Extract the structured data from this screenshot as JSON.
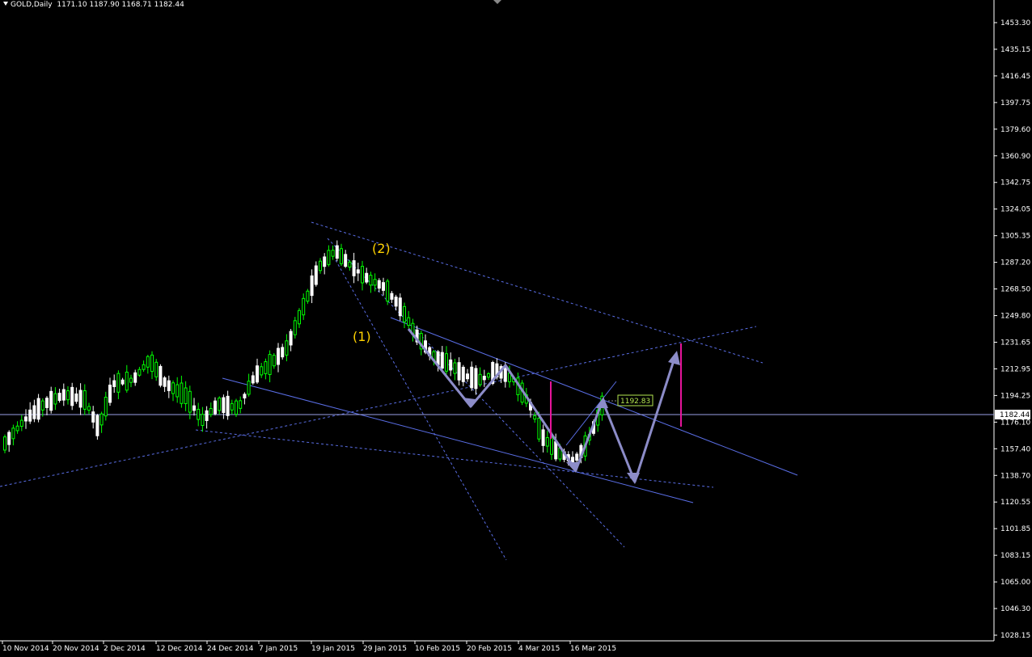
{
  "header": {
    "symbol": "GOLD,Daily",
    "ohlc": "1171.10 1187.90 1168.71 1182.44"
  },
  "price_axis": {
    "labels": [
      "1453.30",
      "1435.15",
      "1416.45",
      "1397.75",
      "1379.60",
      "1360.90",
      "1342.75",
      "1324.05",
      "1305.35",
      "1287.20",
      "1268.50",
      "1249.80",
      "1231.65",
      "1212.95",
      "1194.25",
      "1176.10",
      "1157.40",
      "1138.70",
      "1120.55",
      "1101.85",
      "1083.15",
      "1065.00",
      "1046.30",
      "1028.15"
    ],
    "current_price": "1182.44",
    "marker_label": "1192.83"
  },
  "time_axis": {
    "labels": [
      "10 Nov 2014",
      "20 Nov 2014",
      "2 Dec 2014",
      "12 Dec 2014",
      "24 Dec 2014",
      "7 Jan 2015",
      "19 Jan 2015",
      "29 Jan 2015",
      "10 Feb 2015",
      "20 Feb 2015",
      "4 Mar 2015",
      "16 Mar 2015"
    ]
  },
  "annotations": {
    "wave1": "(1)",
    "wave2": "(2)"
  },
  "colors": {
    "background": "#000000",
    "bull_candle": "#00ff00",
    "bear_candle": "#ffffff",
    "trendline": "#5a6ee6",
    "arrow": "#8c8cc8",
    "target_line": "#e6149b",
    "wave_label": "#ffd200"
  }
}
